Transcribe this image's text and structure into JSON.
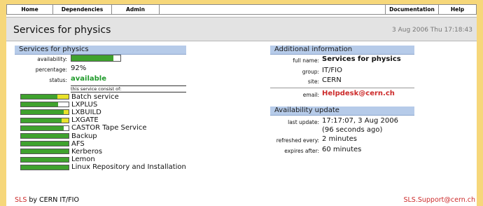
{
  "nav": {
    "home": "Home",
    "dependencies": "Dependencies",
    "admin": "Admin",
    "documentation": "Documentation",
    "help": "Help"
  },
  "header": {
    "title": "Services for physics",
    "timestamp": "3 Aug 2006 Thu 17:18:43"
  },
  "left": {
    "section_title": "Services for physics",
    "availability_label": "availability:",
    "availability_fraction": 0.86,
    "percentage_label": "percentage:",
    "percentage_value": "92%",
    "status_label": "status:",
    "status_value": "available",
    "consist_label": "this service consist of:",
    "services": [
      {
        "name": "Batch service",
        "green": 0.76,
        "yellow": 0.24
      },
      {
        "name": "LXPLUS",
        "green": 0.78,
        "yellow": 0.0
      },
      {
        "name": "LXBUILD",
        "green": 0.9,
        "yellow": 0.1
      },
      {
        "name": "LXGATE",
        "green": 0.86,
        "yellow": 0.14
      },
      {
        "name": "CASTOR Tape Service",
        "green": 0.9,
        "yellow": 0.0
      },
      {
        "name": "Backup",
        "green": 1.0,
        "yellow": 0.0
      },
      {
        "name": "AFS",
        "green": 1.0,
        "yellow": 0.0
      },
      {
        "name": "Kerberos",
        "green": 1.0,
        "yellow": 0.0
      },
      {
        "name": "Lemon",
        "green": 1.0,
        "yellow": 0.0
      },
      {
        "name": "Linux Repository and Installation",
        "green": 1.0,
        "yellow": 0.0
      }
    ]
  },
  "right": {
    "info_title": "Additional information",
    "full_name_label": "full name:",
    "full_name_value": "Services for physics",
    "group_label": "group:",
    "group_value": "IT/FIO",
    "site_label": "site:",
    "site_value": "CERN",
    "email_label": "email:",
    "email_value": "Helpdesk@cern.ch",
    "update_title": "Availability update",
    "last_update_label": "last update:",
    "last_update_value": "17:17:07, 3 Aug 2006",
    "last_update_ago": "(96 seconds ago)",
    "refreshed_label": "refreshed every:",
    "refreshed_value": "2 minutes",
    "expires_label": "expires after:",
    "expires_value": "60 minutes"
  },
  "footer": {
    "sls": "SLS",
    "by": " by CERN IT/FIO",
    "support": "SLS.Support@cern.ch"
  },
  "colors": {
    "background": "#f6d77a",
    "section_header": "#b6cbe9",
    "bar_green": "#3fa22e",
    "bar_yellow": "#e8e22a",
    "link_red": "#cc2a2a"
  }
}
